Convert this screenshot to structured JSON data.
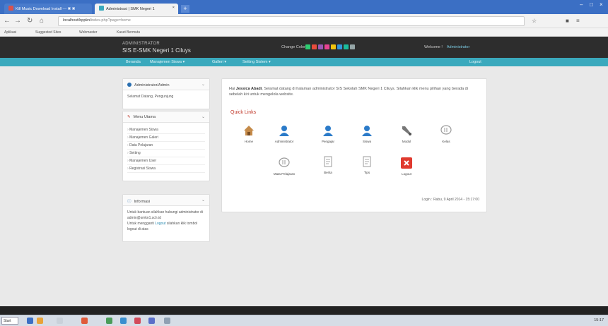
{
  "browser": {
    "tabs": [
      {
        "label": "Kill Music Download Install — ✖ ✖",
        "active": false
      },
      {
        "label": "Administrasi | SMK Negeri 1",
        "active": true
      }
    ],
    "new_tab": "+",
    "url_host": "localhost/bppkn/",
    "url_path": "index.php?page=home",
    "bookmarks": [
      "Aplikasi",
      "Suggested Sites",
      "Webmaster",
      "Kaset Bermutu"
    ]
  },
  "header": {
    "brand_top": "ADMINISTRATOR",
    "brand_main": "SIS E-SMK Negeri 1 Ciluys",
    "theme_label": "Change Color",
    "theme_colors": [
      "#2ecc71",
      "#e74c3c",
      "#9b59b6",
      "#e84393",
      "#f1c40f",
      "#3498db",
      "#1abc9c",
      "#95a5a6"
    ],
    "welcome": "Welcome !",
    "username": "Administrator"
  },
  "menu": {
    "items": [
      "Beranda",
      "Manajemen Siswa ▾",
      "Galleri ▾",
      "Setting Sistem ▾"
    ],
    "right": "Logout"
  },
  "sidebar": {
    "admin_title": "Administrator/Admin",
    "admin_text": "Selamat Datang, Pengunjung",
    "menu_title": "Menu Utama",
    "menu_items": [
      "Manajemen Siswa",
      "Manajemen Galeri",
      "Data Pelajaran",
      "Setting",
      "Manajemen User",
      "Registrasi Siswa"
    ],
    "info_title": "Informasi",
    "info_text": "Untuk bantuan silahkan hubungi administrator di",
    "info_email": "admin@smkn1.sch.id",
    "info_text2": "Untuk mengganti",
    "info_link": "Logout",
    "info_text3": "silahkan klik tombol logout di atas"
  },
  "main": {
    "welcome_lead": "Hai",
    "welcome_name": "Jessica Abadi",
    "welcome_text": ", Selamat datang di halaman administrator SIS Sekolah SMK Negeri 1 Ciluys. Silahkan klik menu pilihan yang berada di sebelah kiri untuk mengelola website.",
    "quick_title": "Quick Links",
    "links": [
      {
        "label": "Home",
        "icon": "home-icon"
      },
      {
        "label": "Administrator",
        "icon": "user-icon"
      },
      {
        "label": "Pengajar",
        "icon": "user-icon"
      },
      {
        "label": "Siswa",
        "icon": "user-icon"
      },
      {
        "label": "Modul",
        "icon": "wrench-icon"
      },
      {
        "label": "Kelas",
        "icon": "chat-icon"
      },
      {
        "label": "Mata Pelajaran",
        "icon": "chat-icon"
      },
      {
        "label": "Berita",
        "icon": "document-icon"
      },
      {
        "label": "Tips",
        "icon": "document-icon"
      },
      {
        "label": "Logout",
        "icon": "logout-icon"
      }
    ],
    "login_info": "Login : Rabu, 9 April 2014 - 15:17:00"
  },
  "taskbar": {
    "start": "Start",
    "clock": "15:17"
  }
}
